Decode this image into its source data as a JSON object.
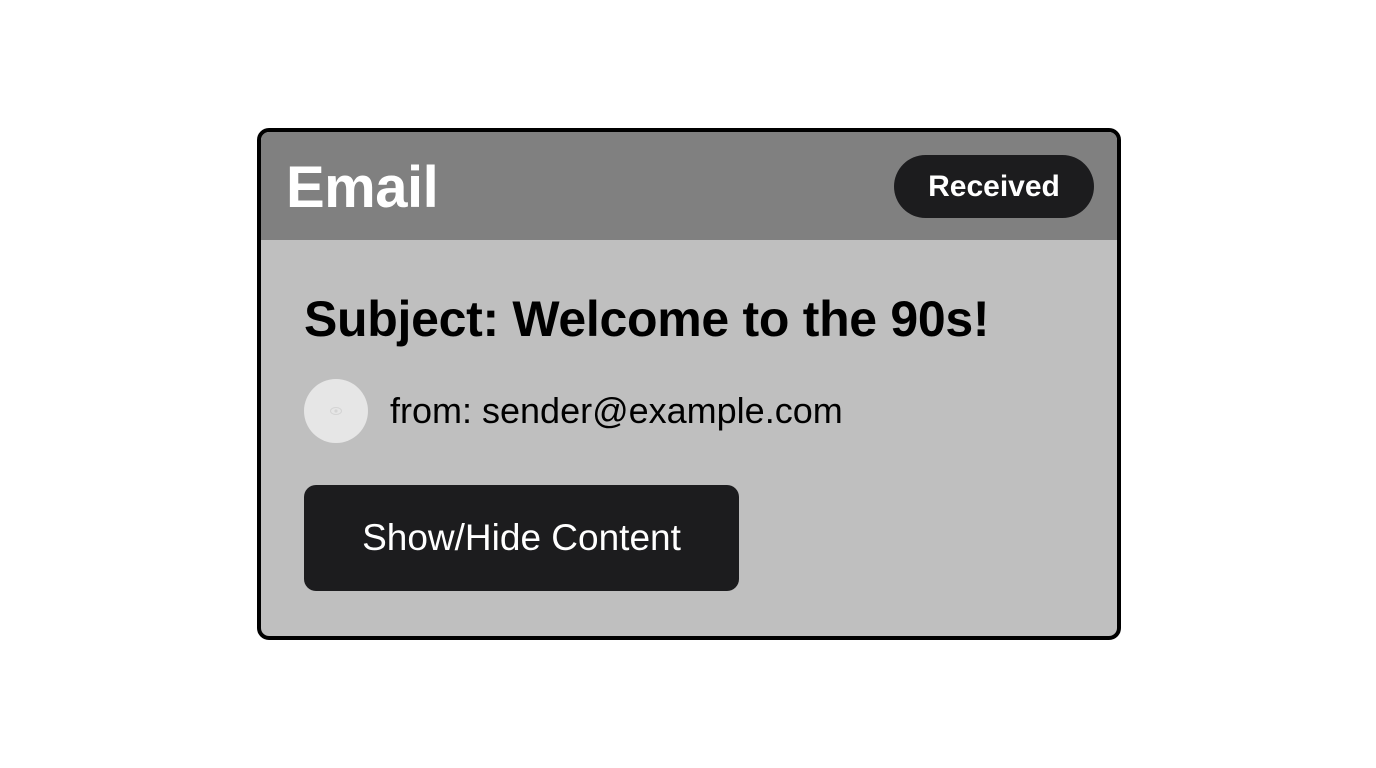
{
  "card": {
    "title": "Email",
    "status_badge": "Received",
    "subject": "Subject: Welcome to the 90s!",
    "sender": "from: sender@example.com",
    "avatar_icon": "eye-icon",
    "toggle_button_label": "Show/Hide Content"
  },
  "colors": {
    "header_bg": "#808080",
    "body_bg": "#bfbfbf",
    "badge_bg": "#1c1c1e",
    "button_bg": "#1c1c1e",
    "avatar_bg": "#e6e6e6",
    "border": "#000000"
  }
}
